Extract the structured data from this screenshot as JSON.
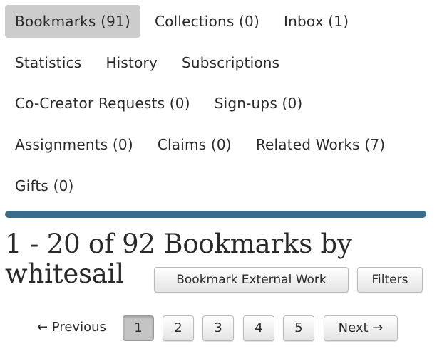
{
  "nav": {
    "rows": [
      [
        {
          "label": "Bookmarks (91)",
          "active": true
        },
        {
          "label": "Collections (0)"
        },
        {
          "label": "Inbox (1)"
        }
      ],
      [
        {
          "label": "Statistics"
        },
        {
          "label": "History"
        },
        {
          "label": "Subscriptions"
        }
      ],
      [
        {
          "label": "Co-Creator Requests (0)"
        },
        {
          "label": "Sign-ups (0)"
        }
      ],
      [
        {
          "label": "Assignments (0)"
        },
        {
          "label": "Claims (0)"
        },
        {
          "label": "Related Works (7)"
        }
      ],
      [
        {
          "label": "Gifts (0)"
        }
      ]
    ],
    "divider_color": "#3a6d8c",
    "active_bg": "#cccccc"
  },
  "heading": {
    "line1": "1 - 20 of 92 Bookmarks by",
    "line2": "whitesail"
  },
  "actions": {
    "bookmark_external": "Bookmark External Work",
    "filters": "Filters"
  },
  "pagination": {
    "previous": "← Previous",
    "pages": [
      "1",
      "2",
      "3",
      "4",
      "5"
    ],
    "current": "1",
    "next": "Next →"
  }
}
